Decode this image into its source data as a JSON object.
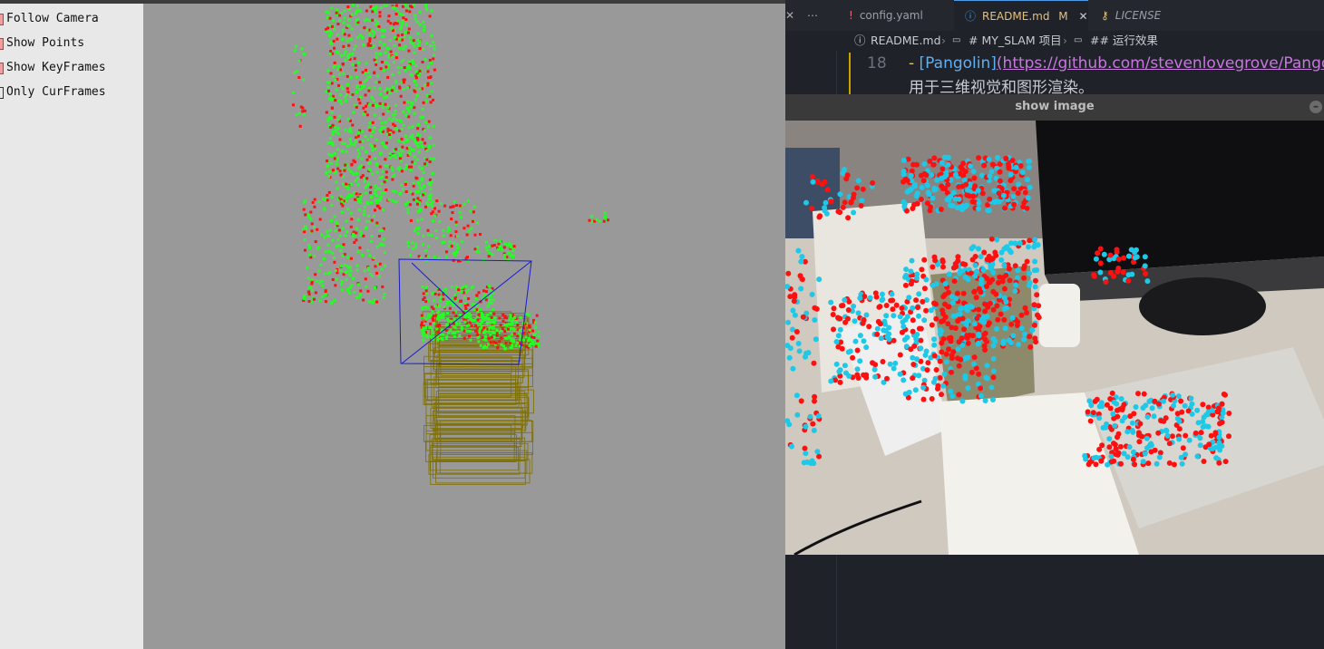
{
  "viewer": {
    "checkboxes": [
      {
        "label": "Follow Camera",
        "checked": true
      },
      {
        "label": "Show Points",
        "checked": true
      },
      {
        "label": "Show KeyFrames",
        "checked": true
      },
      {
        "label": "Only CurFrames",
        "checked": false
      }
    ],
    "colors": {
      "map_points": "#22ff22",
      "active_points": "#ff1010",
      "keyframes": "#807000",
      "current_frame": "#1010d0",
      "background": "#999999"
    }
  },
  "editor": {
    "tabs": [
      {
        "icon": "!",
        "label": "config.yaml",
        "active": false
      },
      {
        "icon": "ⓘ",
        "label": "README.md",
        "badge": "M",
        "active": true
      },
      {
        "icon": "🔑",
        "label": "LICENSE",
        "active": false
      }
    ],
    "breadcrumb": {
      "file": "README.md",
      "h1": "# MY_SLAM 项目",
      "h2": "## 运行效果"
    },
    "line_number": "18",
    "line_text_prefix": "- ",
    "link_text": "[Pangolin]",
    "link_url": "(https://github.com/stevenlovegrove/Pango",
    "line2": "用于三维视觉和图形渲染。"
  },
  "image_window": {
    "title": "show image",
    "colors": {
      "tracked": "#1ec8e6",
      "untracked": "#ff1010"
    }
  }
}
